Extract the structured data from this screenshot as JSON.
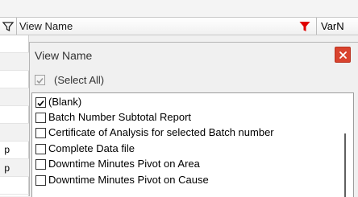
{
  "header": {
    "column_view_name": "View Name",
    "column_varname": "VarN"
  },
  "grid": {
    "row_fragments": [
      "p",
      "p"
    ]
  },
  "popup": {
    "title": "View Name",
    "close_symbol": "×",
    "select_all": {
      "label": "(Select All)",
      "checked": true,
      "disabled": true
    },
    "items": [
      {
        "label": "(Blank)",
        "checked": true
      },
      {
        "label": "Batch Number Subtotal Report",
        "checked": false
      },
      {
        "label": "Certificate of Analysis for selected Batch number",
        "checked": false
      },
      {
        "label": "Complete Data file",
        "checked": false
      },
      {
        "label": "Downtime Minutes Pivot on Area",
        "checked": false
      },
      {
        "label": "Downtime Minutes Pivot on Cause",
        "checked": false
      }
    ]
  },
  "colors": {
    "filter_active": "#e00000",
    "close_button": "#d9432e"
  },
  "icons": {
    "column_filter": "funnel-icon",
    "active_filter": "funnel-filled-icon",
    "close": "close-icon",
    "checkmark": "checkmark-icon"
  }
}
